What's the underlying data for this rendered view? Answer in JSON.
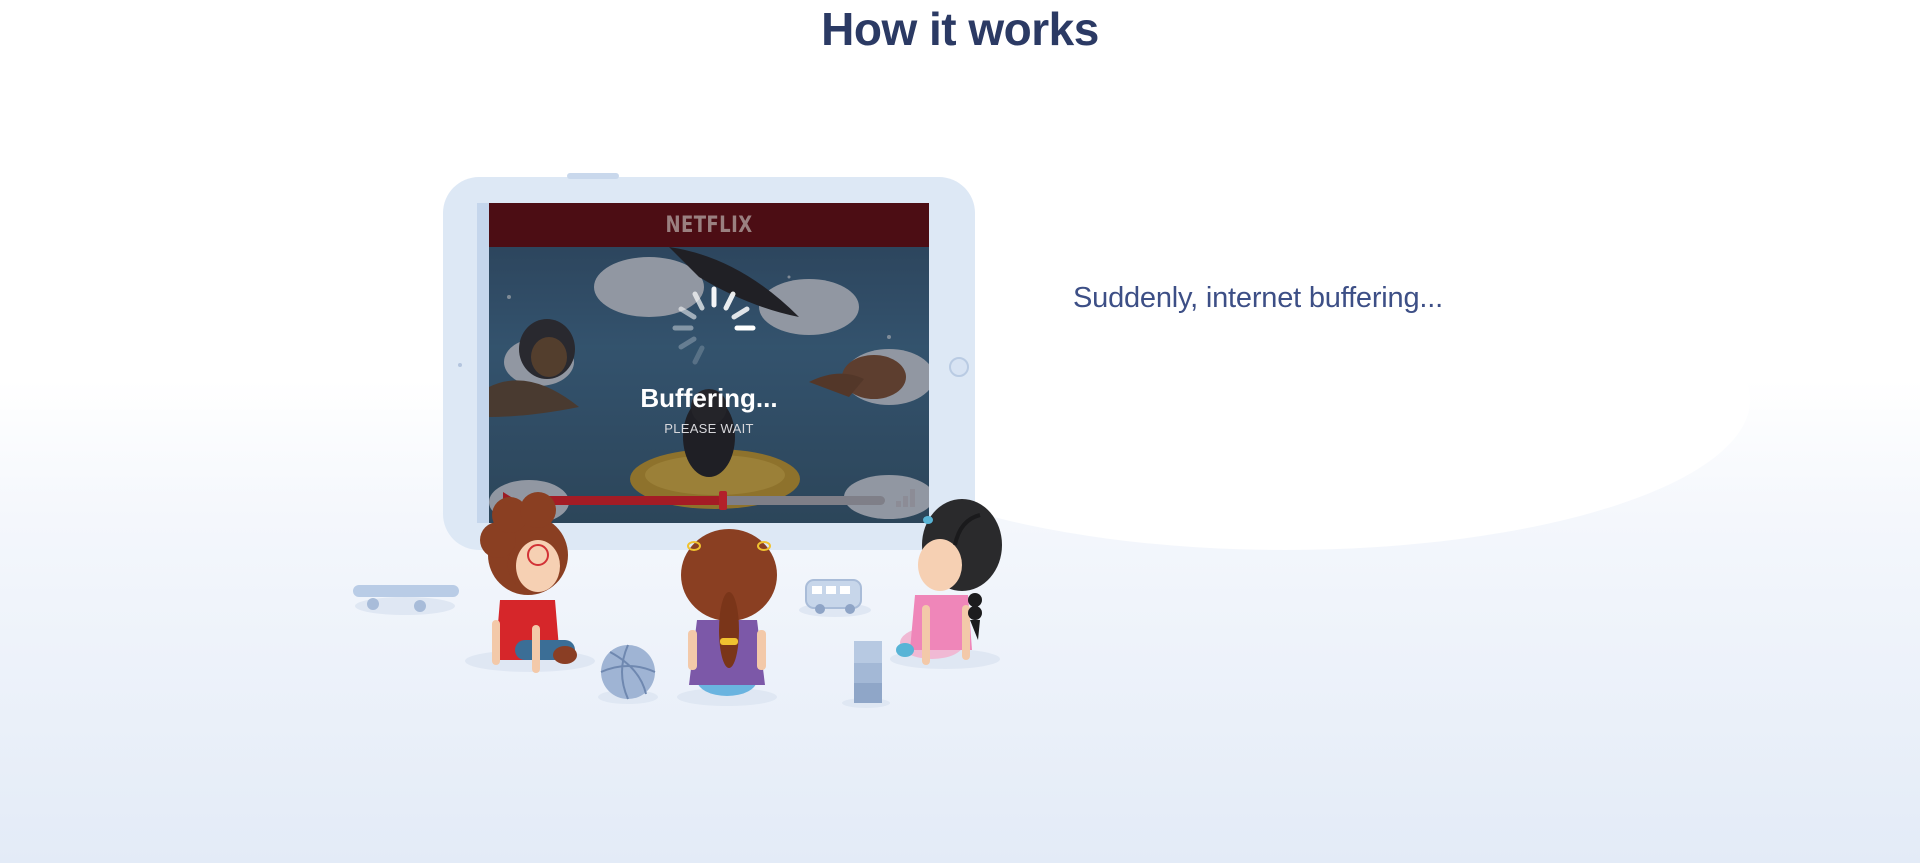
{
  "section": {
    "title": "How it works"
  },
  "step": {
    "text": "Suddenly, internet buffering..."
  },
  "player": {
    "brand": "NETFLIX",
    "status_title": "Buffering...",
    "status_sub": "PLEASE WAIT",
    "progress": 0.54
  },
  "colors": {
    "title": "#2b3a64",
    "text": "#3d4f86",
    "brand_bar": "#4c0d14",
    "accent_red": "#a41c25",
    "tablet": "#dde8f5"
  },
  "icons": {
    "spinner": "loading-spinner-icon",
    "play": "play-icon",
    "signal": "signal-bars-icon"
  }
}
